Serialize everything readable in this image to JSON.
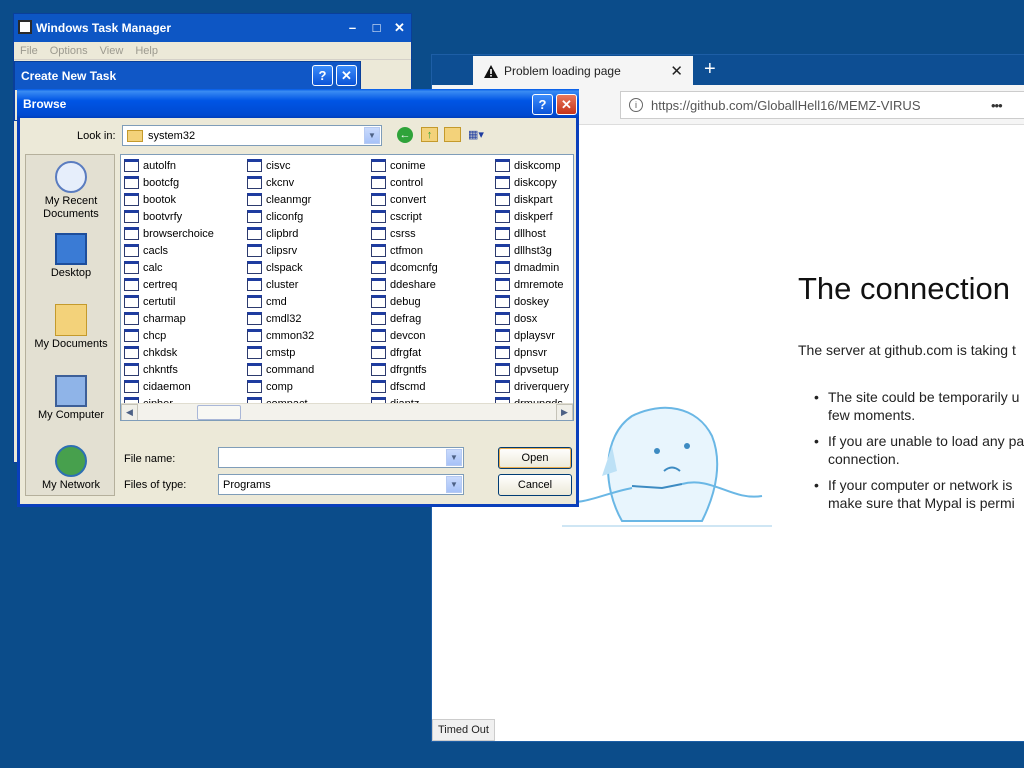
{
  "task_manager": {
    "title": "Windows Task Manager",
    "menu": [
      "File",
      "Options",
      "View",
      "Help"
    ]
  },
  "create_task": {
    "title": "Create New Task"
  },
  "browse": {
    "title": "Browse",
    "look_in_label": "Look in:",
    "look_in_value": "system32",
    "places": [
      "My Recent Documents",
      "Desktop",
      "My Documents",
      "My Computer",
      "My Network"
    ],
    "files": [
      [
        "autolfn",
        "bootcfg",
        "bootok",
        "bootvrfy",
        "browserchoice",
        "cacls",
        "calc",
        "certreq",
        "certutil",
        "charmap",
        "chcp",
        "chkdsk",
        "chkntfs",
        "cidaemon",
        "cipher"
      ],
      [
        "cisvc",
        "ckcnv",
        "cleanmgr",
        "cliconfg",
        "clipbrd",
        "clipsrv",
        "clspack",
        "cluster",
        "cmd",
        "cmdl32",
        "cmmon32",
        "cmstp",
        "command",
        "comp",
        "compact"
      ],
      [
        "conime",
        "control",
        "convert",
        "cscript",
        "csrss",
        "ctfmon",
        "dcomcnfg",
        "ddeshare",
        "debug",
        "defrag",
        "devcon",
        "dfrgfat",
        "dfrgntfs",
        "dfscmd",
        "diantz"
      ],
      [
        "diskcomp",
        "diskcopy",
        "diskpart",
        "diskperf",
        "dllhost",
        "dllhst3g",
        "dmadmin",
        "dmremote",
        "doskey",
        "dosx",
        "dplaysvr",
        "dpnsvr",
        "dpvsetup",
        "driverquery",
        "drmupgds"
      ]
    ],
    "file_name_label": "File name:",
    "file_name_value": "",
    "file_type_label": "Files of type:",
    "file_type_value": "Programs",
    "open_label": "Open",
    "cancel_label": "Cancel"
  },
  "browser": {
    "tab_title": "Problem loading page",
    "new_tab_symbol": "+",
    "url": "https://github.com/GloballHell16/MEMZ-VIRUS",
    "more_symbol": "•••",
    "error_title": "The connection",
    "error_desc": "The server at github.com is taking t",
    "bullets": [
      [
        "The site could be temporarily u",
        "few moments."
      ],
      [
        "If you are unable to load any pa",
        "connection."
      ],
      [
        "If your computer or network is",
        "make sure that Mypal is permi"
      ]
    ],
    "status": "Timed Out"
  }
}
